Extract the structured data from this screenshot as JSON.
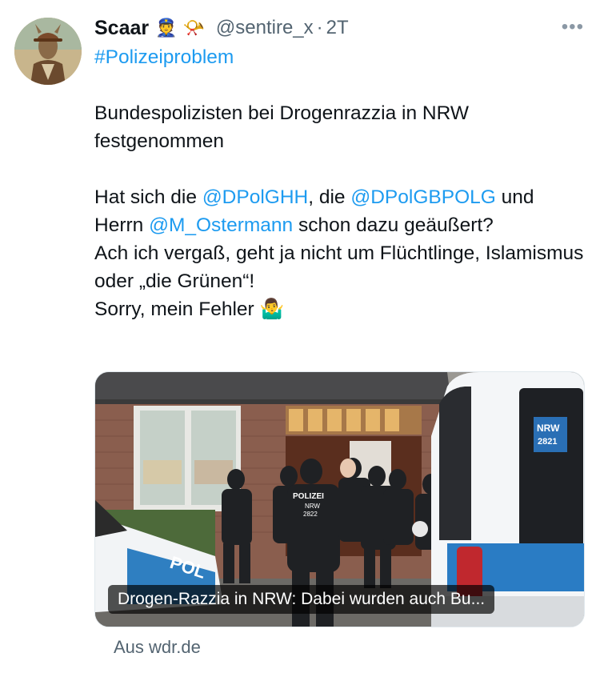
{
  "tweet": {
    "author_name": "Scaar",
    "author_emojis": "👮 📯",
    "handle": "@sentire_x",
    "separator": "·",
    "time": "2T",
    "more_label": "•••",
    "hashtag": "#Polizeiproblem",
    "line1": "Bundespolizisten bei Drogenrazzia in NRW festgenommen",
    "p2_a": "Hat sich die ",
    "mention1": "@DPolGHH",
    "p2_b": ", die ",
    "mention2": "@DPolGBPOLG",
    "p2_c": " und Herrn ",
    "mention3": "@M_Ostermann",
    "p2_d": " schon dazu geäußert?",
    "line3": "Ach ich vergaß, geht ja nicht um Flüchtlinge, Islamismus oder „die Grünen“!",
    "line4": "Sorry, mein Fehler 🤷‍♂️"
  },
  "card": {
    "caption": "Drogen-Razzia in NRW: Dabei wurden auch Bu...",
    "source": "Aus wdr.de",
    "van_label_1": "NRW",
    "van_label_2": "2821",
    "vest_label": "POLIZEI",
    "vest_sub": "NRW",
    "vest_num": "2822",
    "car_text": "POL"
  }
}
